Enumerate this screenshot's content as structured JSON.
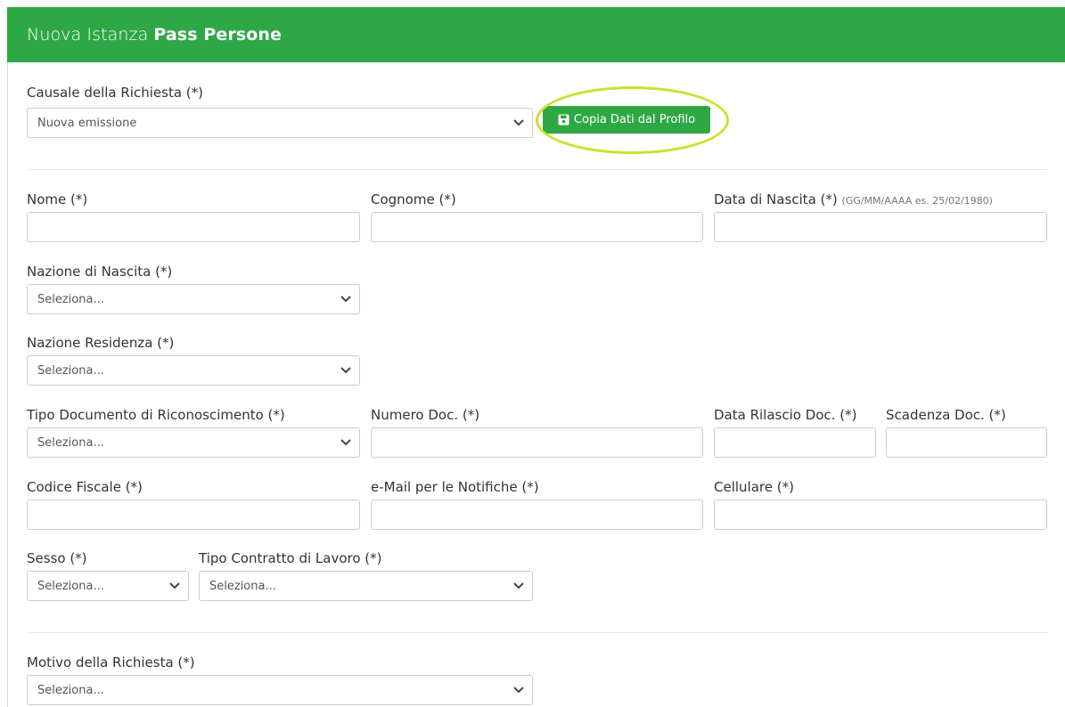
{
  "header": {
    "title_light": "Nuova Istanza",
    "title_bold": "Pass Persone"
  },
  "causale": {
    "label": "Causale della Richiesta (*)",
    "value": "Nuova emissione"
  },
  "copy_button": {
    "label": "Copia Dati dal Profilo"
  },
  "nome": {
    "label": "Nome (*)"
  },
  "cognome": {
    "label": "Cognome (*)"
  },
  "data_nascita": {
    "label": "Data di Nascita (*)",
    "hint": "(GG/MM/AAAA es. 25/02/1980)"
  },
  "nazione_nascita": {
    "label": "Nazione di Nascita (*)",
    "value": "Seleziona..."
  },
  "nazione_residenza": {
    "label": "Nazione Residenza (*)",
    "value": "Seleziona..."
  },
  "tipo_documento": {
    "label": "Tipo Documento di Riconoscimento (*)",
    "value": "Seleziona..."
  },
  "numero_doc": {
    "label": "Numero Doc. (*)"
  },
  "data_rilascio": {
    "label": "Data Rilascio Doc. (*)"
  },
  "scadenza_doc": {
    "label": "Scadenza Doc. (*)"
  },
  "codice_fiscale": {
    "label": "Codice Fiscale (*)"
  },
  "email": {
    "label": "e-Mail per le Notifiche (*)"
  },
  "cellulare": {
    "label": "Cellulare (*)"
  },
  "sesso": {
    "label": "Sesso (*)",
    "value": "Seleziona..."
  },
  "tipo_contratto": {
    "label": "Tipo Contratto di Lavoro (*)",
    "value": "Seleziona..."
  },
  "motivo": {
    "label": "Motivo della Richiesta (*)",
    "value": "Seleziona..."
  },
  "colors": {
    "header_green": "#2ea845",
    "highlight": "#c7e32b"
  }
}
